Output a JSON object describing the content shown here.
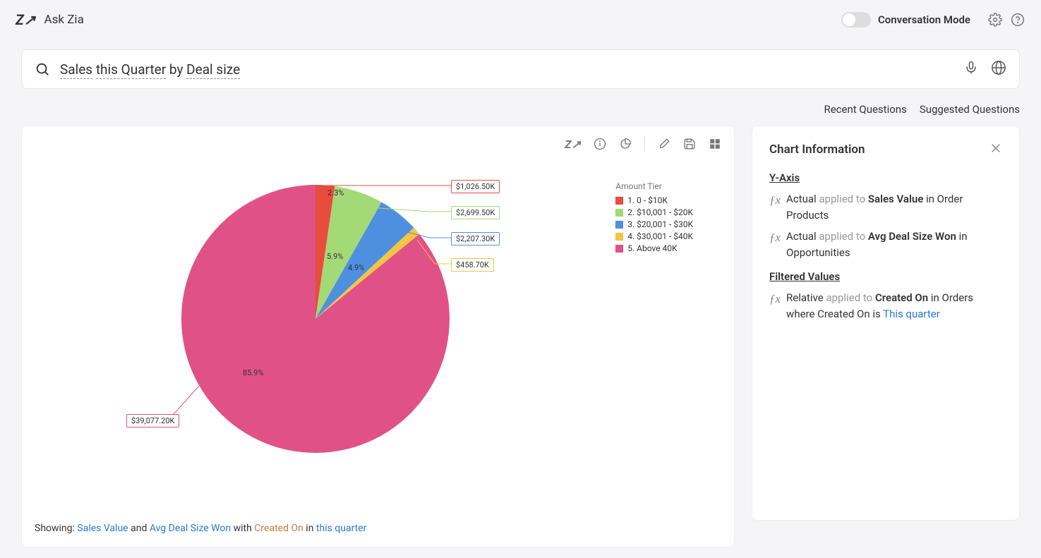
{
  "header": {
    "title": "Ask Zia",
    "mode_label": "Conversation Mode"
  },
  "search": {
    "q1": "Sales",
    "q2": "this Quarter",
    "q3": " by ",
    "q4": "Deal size"
  },
  "links": {
    "recent": "Recent Questions",
    "suggested": "Suggested Questions"
  },
  "chart_data": {
    "type": "pie",
    "title": "",
    "legend_title": "Amount Tier",
    "series": [
      {
        "name": "1. 0 - $10K",
        "pct": 2.3,
        "value": "$1,026.50K",
        "color": "#e84c3d"
      },
      {
        "name": "2. $10,001 - $20K",
        "pct": 5.9,
        "value": "$2,699.50K",
        "color": "#a3d977"
      },
      {
        "name": "3. $20,001 - $30K",
        "pct": 4.9,
        "value": "$2,207.30K",
        "color": "#4f8fe0"
      },
      {
        "name": "4. $30,001 - $40K",
        "pct": 1.0,
        "value": "$458.70K",
        "color": "#f4c542"
      },
      {
        "name": "5. Above 40K",
        "pct": 85.9,
        "value": "$39,077.20K",
        "color": "#e05287"
      }
    ],
    "pct_labels": {
      "p1": "2.3%",
      "p2": "5.9%",
      "p3": "4.9%",
      "p5": "85.9%"
    }
  },
  "showing": {
    "prefix": "Showing:  ",
    "sales_value": "Sales Value",
    "and": " and ",
    "avg_deal": "Avg Deal Size Won",
    "with": " with ",
    "created_on": "Created On",
    "in": " in ",
    "this_quarter": "this quarter"
  },
  "info": {
    "title": "Chart Information",
    "yaxis": "Y-Axis",
    "y1_a": "Actual ",
    "y1_b": "applied to ",
    "y1_c": "Sales Value",
    "y1_d": " in Order Products",
    "y2_a": "Actual ",
    "y2_b": "applied to ",
    "y2_c": "Avg Deal Size Won",
    "y2_d": " in Opportunities",
    "filtered": "Filtered Values",
    "f1_a": "Relative ",
    "f1_b": "applied to ",
    "f1_c": "Created On",
    "f1_d": " in Orders where Created On is ",
    "f1_e": "This quarter"
  }
}
